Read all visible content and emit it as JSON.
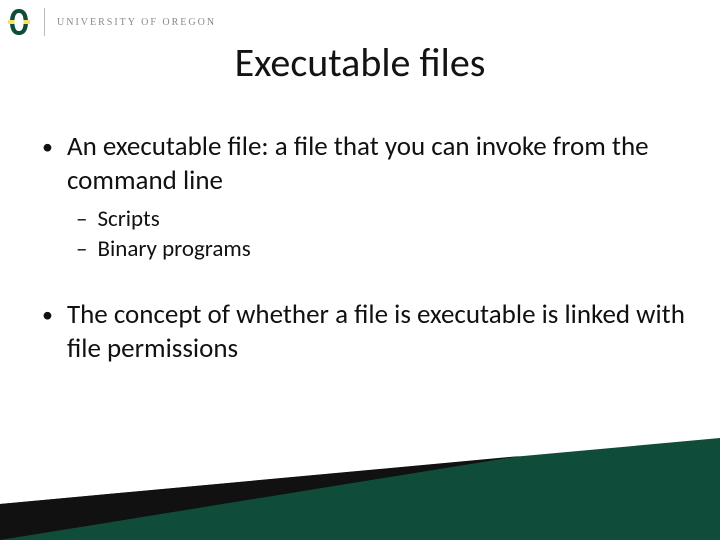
{
  "header": {
    "university": "UNIVERSITY OF OREGON"
  },
  "title": "Executable files",
  "bullets": [
    {
      "text": "An executable file: a file that you can invoke from the command line",
      "sub": [
        "Scripts",
        "Binary programs"
      ]
    },
    {
      "text": "The concept of whether a file is executable is linked with file permissions",
      "sub": []
    }
  ],
  "colors": {
    "brand_green": "#0f4d3a",
    "brand_dark": "#111111",
    "brand_yellow": "#f7e06a"
  }
}
